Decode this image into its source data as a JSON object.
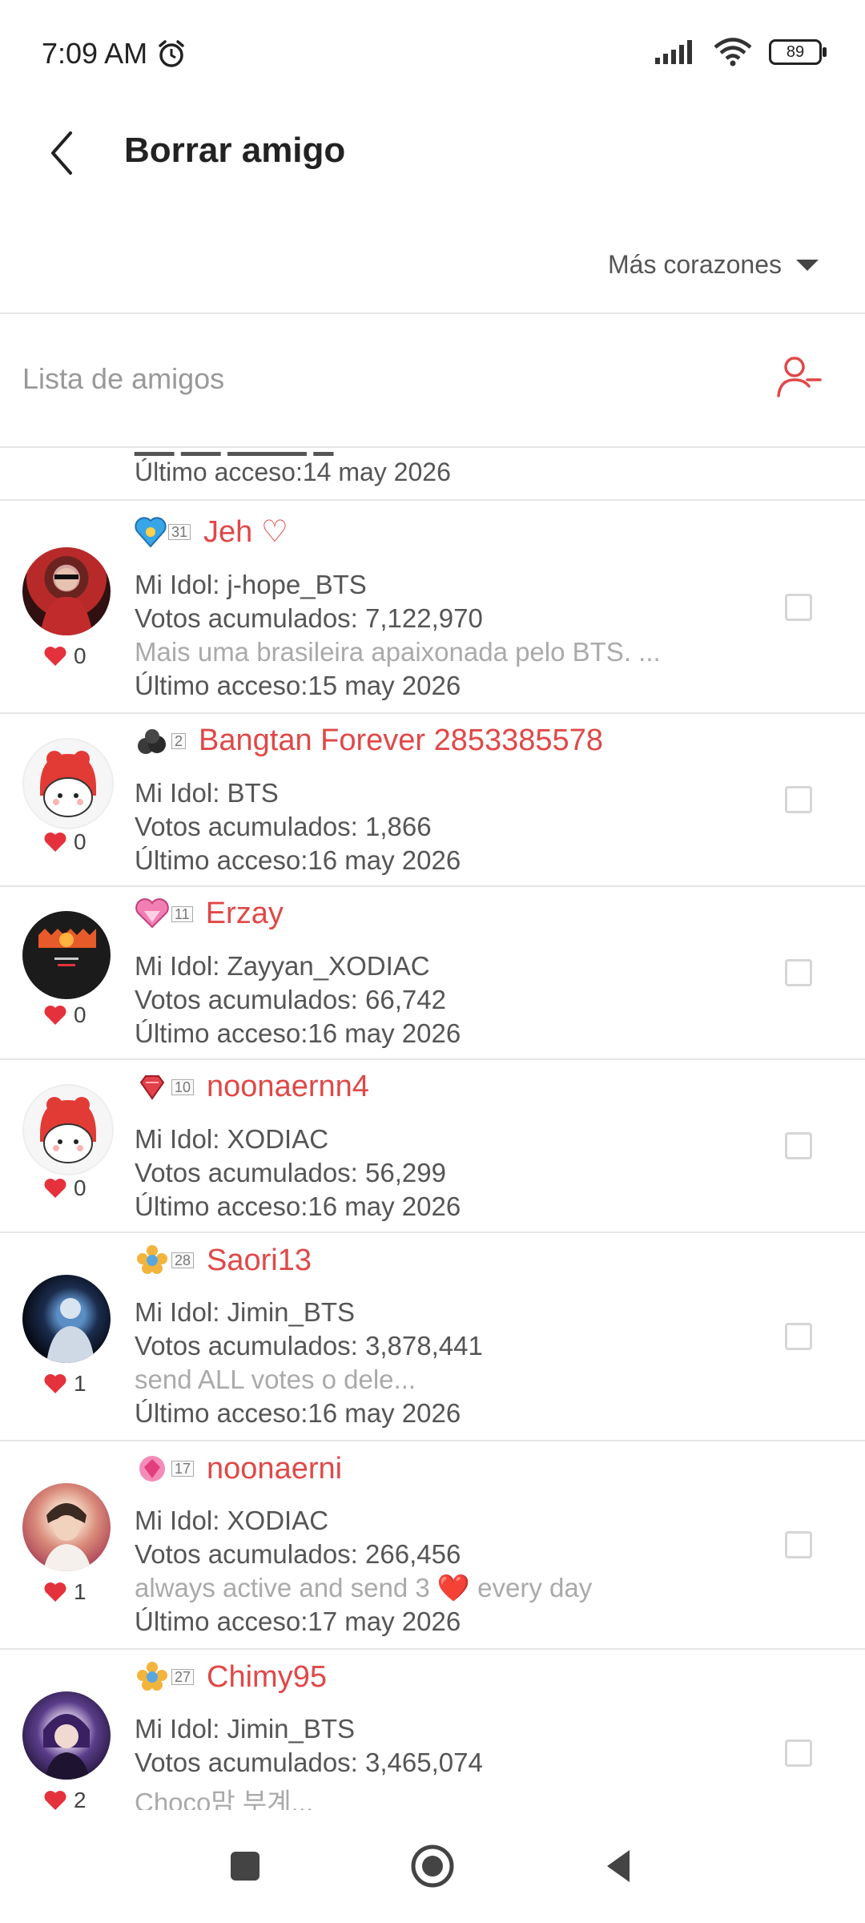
{
  "status_bar": {
    "time": "7:09 AM",
    "battery": "89"
  },
  "header": {
    "title": "Borrar amigo"
  },
  "sort": {
    "label": "Más corazones"
  },
  "list": {
    "title": "Lista de amigos"
  },
  "partial_row": {
    "last_access": "Último acceso:14 may 2026"
  },
  "friends": [
    {
      "level": "31",
      "badge": "heart-badge",
      "name": "Jeh ♡",
      "idol": "Mi Idol: j-hope_BTS",
      "votes": "Votos acumulados: 7,122,970",
      "bio": "Mais uma brasileira apaixonada pelo BTS. ...",
      "last_access": "Último acceso:15 may 2026",
      "hearts": "0"
    },
    {
      "level": "2",
      "badge": "coal-badge",
      "name": "Bangtan Forever 2853385578",
      "idol": "Mi Idol: BTS",
      "votes": "Votos acumulados: 1,866",
      "bio": "",
      "last_access": "Último acceso:16 may 2026",
      "hearts": "0"
    },
    {
      "level": "11",
      "badge": "diamond-heart-badge",
      "name": "Erzay",
      "idol": "Mi Idol: Zayyan_XODIAC",
      "votes": "Votos acumulados: 66,742",
      "bio": "",
      "last_access": "Último acceso:16 may 2026",
      "hearts": "0"
    },
    {
      "level": "10",
      "badge": "ruby-badge",
      "name": "noonaernn4",
      "idol": "Mi Idol: XODIAC",
      "votes": "Votos acumulados: 56,299",
      "bio": "",
      "last_access": "Último acceso:16 may 2026",
      "hearts": "0"
    },
    {
      "level": "28",
      "badge": "flower-badge",
      "name": "Saori13",
      "idol": "Mi Idol: Jimin_BTS",
      "votes": "Votos acumulados: 3,878,441",
      "bio": "send ALL  votes o dele...",
      "last_access": "Último acceso:16 may 2026",
      "hearts": "1"
    },
    {
      "level": "17",
      "badge": "pink-gem-badge",
      "name": "noonaerni",
      "idol": "Mi Idol: XODIAC",
      "votes": "Votos acumulados: 266,456",
      "bio": "always active and send 3 ❤️ every day",
      "last_access": "Último acceso:17 may 2026",
      "hearts": "1"
    },
    {
      "level": "27",
      "badge": "flower-badge",
      "name": "Chimy95",
      "idol": "Mi Idol: Jimin_BTS",
      "votes": "Votos acumulados: 3,465,074",
      "bio": "Choco맘 부계...",
      "last_access": "",
      "hearts": "2"
    }
  ],
  "colors": {
    "accent": "#e04848",
    "heart": "#e5313c",
    "muted": "#aaaaaa",
    "divider": "#e6e6e6"
  }
}
